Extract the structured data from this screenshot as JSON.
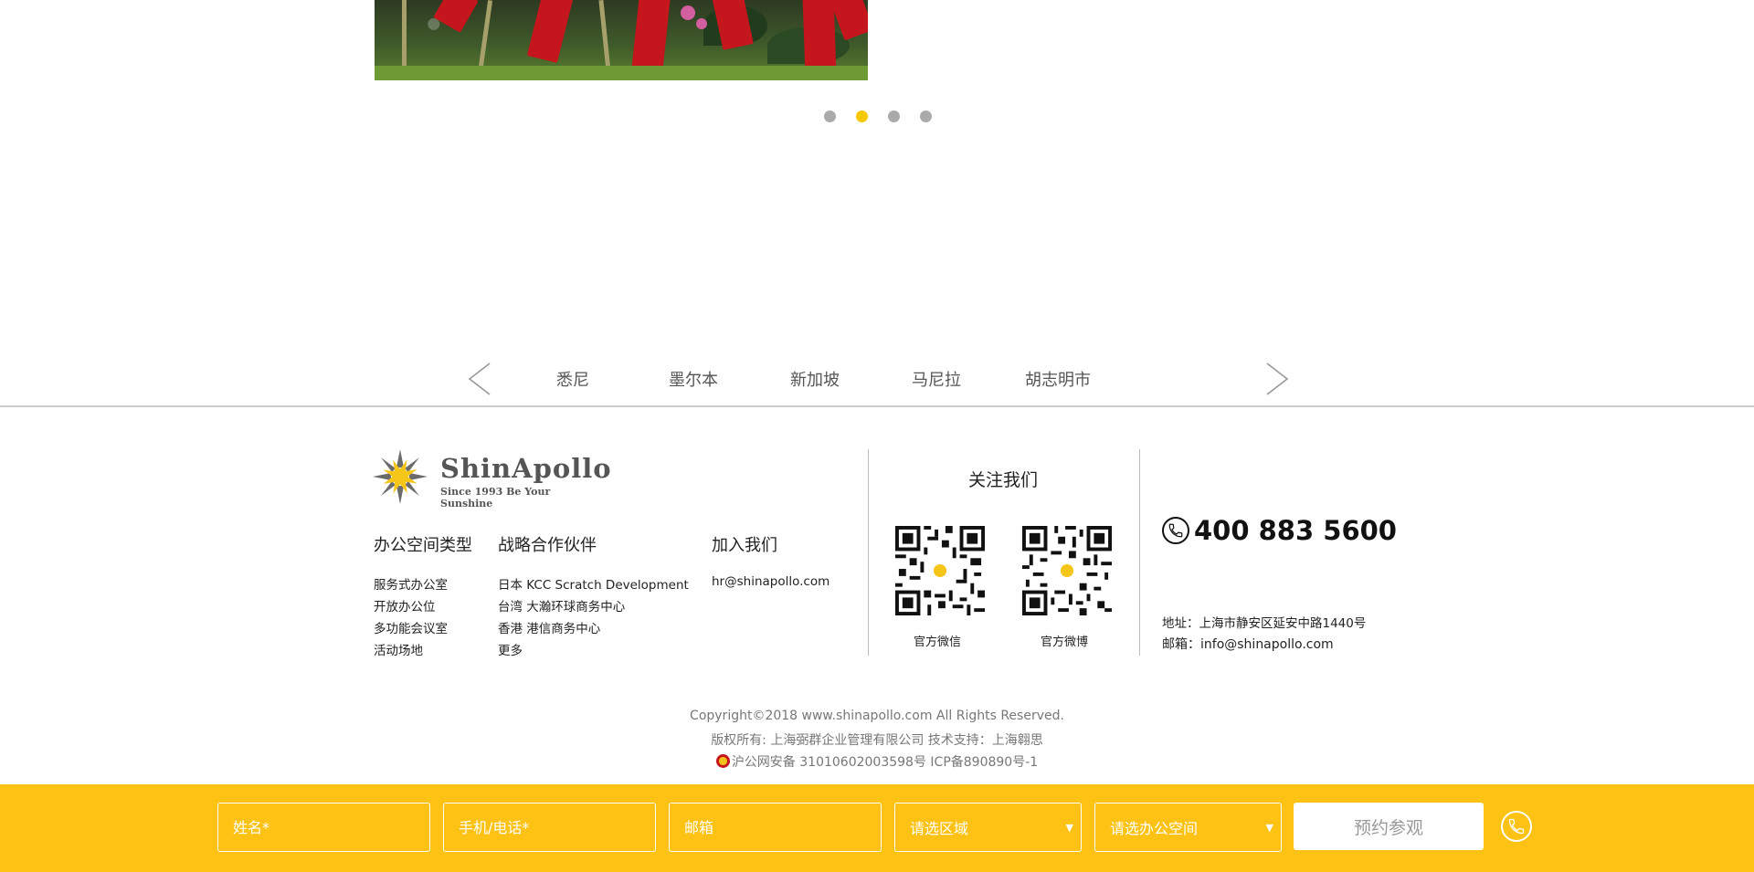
{
  "carousel": {
    "dots": 4,
    "active_index": 1
  },
  "city_nav": {
    "cities": [
      "悉尼",
      "墨尔本",
      "新加坡",
      "马尼拉",
      "胡志明市"
    ]
  },
  "footer": {
    "logo": {
      "name": "ShinApollo",
      "tagline": "Since 1993    Be Your Sunshine"
    },
    "columns": [
      {
        "title": "办公空间类型",
        "items": [
          "服务式办公室",
          "开放办公位",
          "多功能会议室",
          "活动场地"
        ]
      },
      {
        "title": "战略合作伙伴",
        "items": [
          "日本 KCC Scratch Development",
          "台湾 大瀚环球商务中心",
          "香港 港信商务中心",
          "更多"
        ]
      },
      {
        "title": "加入我们",
        "items": [
          "hr@shinapollo.com"
        ]
      }
    ],
    "follow": {
      "title": "关注我们",
      "qr_labels": [
        "官方微信",
        "官方微博"
      ]
    },
    "contact": {
      "phone": "400 883 5600",
      "address": "地址：上海市静安区延安中路1440号",
      "email": "邮箱：info@shinapollo.com"
    },
    "copyright": {
      "line1": "Copyright©2018 www.shinapollo.com All Rights Reserved.",
      "line2": "版权所有: 上海弼群企业管理有限公司  技术支持：上海翱思",
      "line3": "沪公网安备 31010602003598号  ICP备890890号-1"
    }
  },
  "booking": {
    "name_placeholder": "姓名*",
    "phone_placeholder": "手机/电话*",
    "email_placeholder": "邮箱",
    "region_select": "请选区域",
    "space_select": "请选办公空间",
    "submit_label": "预约参观"
  },
  "colors": {
    "accent": "#fdc214",
    "dot_active": "#f7c800",
    "dot_inactive": "#aaaaaa"
  }
}
